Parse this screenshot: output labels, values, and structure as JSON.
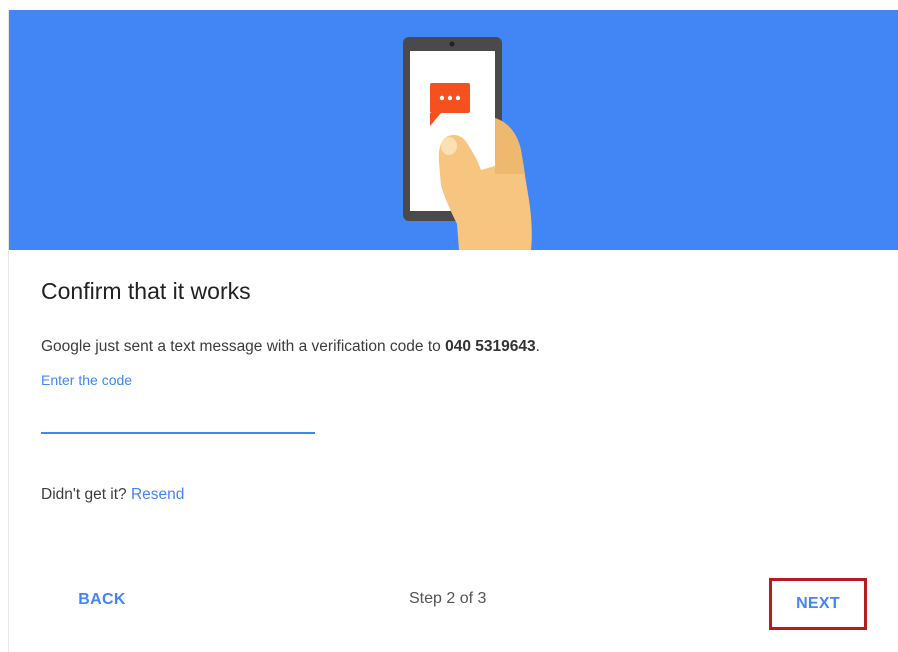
{
  "page": {
    "title": "Confirm that it works",
    "message_prefix": "Google just sent a text message with a verification code to ",
    "phone_number": "040 5319643",
    "message_suffix": ".",
    "input_label": "Enter the code",
    "input_value": "",
    "resend_prefix": "Didn't get it? ",
    "resend_link": "Resend"
  },
  "footer": {
    "back_label": "BACK",
    "step_text": "Step 2 of 3",
    "next_label": "NEXT"
  },
  "colors": {
    "hero_background": "#4285f4",
    "accent": "#4285f4",
    "highlight_box": "#b71c1c",
    "message_bubble": "#f4511e"
  },
  "icons": {
    "illustration": "phone-in-hand-icon",
    "bubble": "message-bubble-icon"
  }
}
